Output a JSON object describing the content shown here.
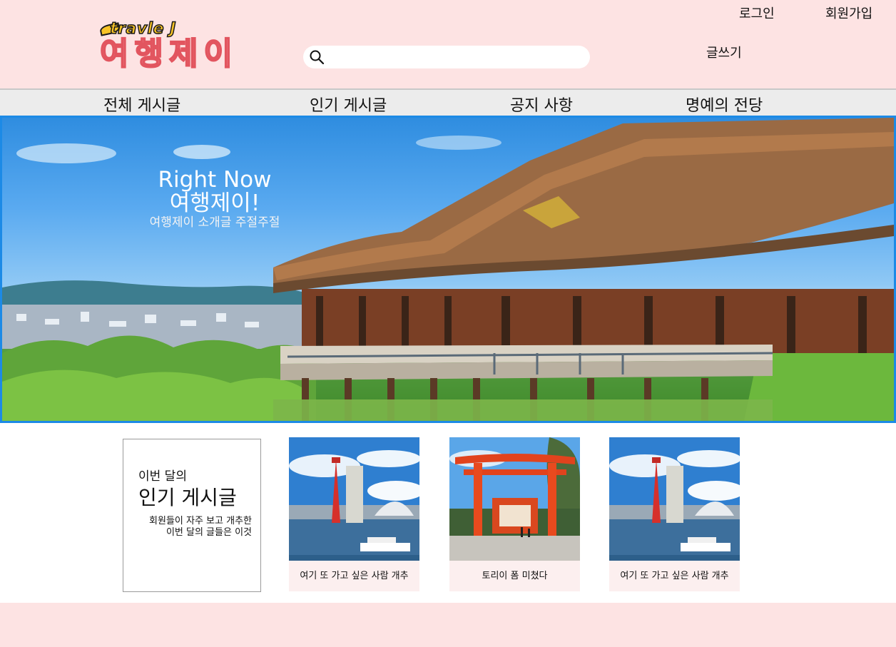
{
  "header": {
    "logo_top": "travle J",
    "logo_main": "여행제이",
    "search": {
      "placeholder": ""
    },
    "login": "로그인",
    "signup": "회원가입",
    "write": "글쓰기"
  },
  "nav": {
    "items": [
      {
        "label": "전체 게시글"
      },
      {
        "label": "인기 게시글"
      },
      {
        "label": "공지 사항"
      },
      {
        "label": "명예의 전당"
      }
    ]
  },
  "hero": {
    "title": "Right Now",
    "subtitle": "여행제이!",
    "description": "여행제이 소개글 주절주절"
  },
  "popular": {
    "small": "이번 달의",
    "big": "인기 게시글",
    "desc_line1": "회원들이 자주 보고 개추한",
    "desc_line2": "이번 달의 글들은 이것",
    "cards": [
      {
        "caption": "여기 또 가고 싶은 사람 개추"
      },
      {
        "caption": "토리이 폼 미쳤다"
      },
      {
        "caption": "여기 또 가고 싶은 사람 개추"
      }
    ]
  },
  "colors": {
    "header_bg": "#fde3e3",
    "nav_bg": "#ececec",
    "hero_border": "#1c8ae6",
    "card_bg": "#fcefef"
  }
}
